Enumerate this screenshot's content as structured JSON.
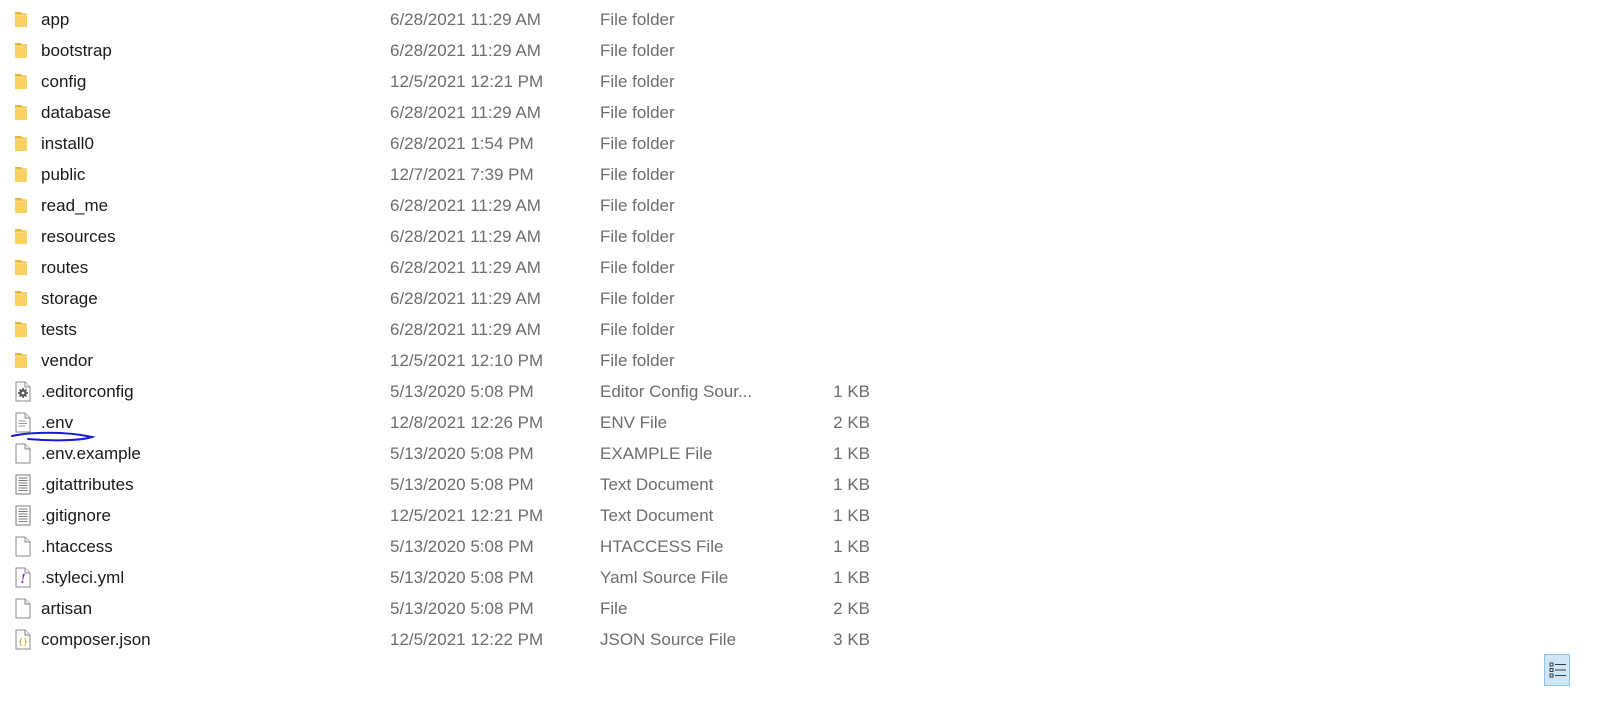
{
  "files": [
    {
      "name": "app",
      "date": "6/28/2021 11:29 AM",
      "type": "File folder",
      "size": "",
      "icon": "folder-icon"
    },
    {
      "name": "bootstrap",
      "date": "6/28/2021 11:29 AM",
      "type": "File folder",
      "size": "",
      "icon": "folder-icon"
    },
    {
      "name": "config",
      "date": "12/5/2021 12:21 PM",
      "type": "File folder",
      "size": "",
      "icon": "folder-icon"
    },
    {
      "name": "database",
      "date": "6/28/2021 11:29 AM",
      "type": "File folder",
      "size": "",
      "icon": "folder-icon"
    },
    {
      "name": "install0",
      "date": "6/28/2021 1:54 PM",
      "type": "File folder",
      "size": "",
      "icon": "folder-icon"
    },
    {
      "name": "public",
      "date": "12/7/2021 7:39 PM",
      "type": "File folder",
      "size": "",
      "icon": "folder-icon"
    },
    {
      "name": "read_me",
      "date": "6/28/2021 11:29 AM",
      "type": "File folder",
      "size": "",
      "icon": "folder-icon"
    },
    {
      "name": "resources",
      "date": "6/28/2021 11:29 AM",
      "type": "File folder",
      "size": "",
      "icon": "folder-icon"
    },
    {
      "name": "routes",
      "date": "6/28/2021 11:29 AM",
      "type": "File folder",
      "size": "",
      "icon": "folder-icon"
    },
    {
      "name": "storage",
      "date": "6/28/2021 11:29 AM",
      "type": "File folder",
      "size": "",
      "icon": "folder-icon"
    },
    {
      "name": "tests",
      "date": "6/28/2021 11:29 AM",
      "type": "File folder",
      "size": "",
      "icon": "folder-icon"
    },
    {
      "name": "vendor",
      "date": "12/5/2021 12:10 PM",
      "type": "File folder",
      "size": "",
      "icon": "folder-icon"
    },
    {
      "name": ".editorconfig",
      "date": "5/13/2020 5:08 PM",
      "type": "Editor Config Sour...",
      "size": "1 KB",
      "icon": "config-file-icon"
    },
    {
      "name": ".env",
      "date": "12/8/2021 12:26 PM",
      "type": "ENV File",
      "size": "2 KB",
      "icon": "text-file-icon"
    },
    {
      "name": ".env.example",
      "date": "5/13/2020 5:08 PM",
      "type": "EXAMPLE File",
      "size": "1 KB",
      "icon": "blank-file-icon"
    },
    {
      "name": ".gitattributes",
      "date": "5/13/2020 5:08 PM",
      "type": "Text Document",
      "size": "1 KB",
      "icon": "text-document-icon"
    },
    {
      "name": ".gitignore",
      "date": "12/5/2021 12:21 PM",
      "type": "Text Document",
      "size": "1 KB",
      "icon": "text-document-icon"
    },
    {
      "name": ".htaccess",
      "date": "5/13/2020 5:08 PM",
      "type": "HTACCESS File",
      "size": "1 KB",
      "icon": "blank-file-icon"
    },
    {
      "name": ".styleci.yml",
      "date": "5/13/2020 5:08 PM",
      "type": "Yaml Source File",
      "size": "1 KB",
      "icon": "yaml-file-icon"
    },
    {
      "name": "artisan",
      "date": "5/13/2020 5:08 PM",
      "type": "File",
      "size": "2 KB",
      "icon": "blank-file-icon"
    },
    {
      "name": "composer.json",
      "date": "12/5/2021 12:22 PM",
      "type": "JSON Source File",
      "size": "3 KB",
      "icon": "json-file-icon"
    }
  ],
  "colors": {
    "folder": "#f5c542",
    "annotation": "#1a1adf",
    "secondary_text": "#6d6d6d"
  },
  "view_toggle": {
    "icon": "details-view-icon"
  }
}
